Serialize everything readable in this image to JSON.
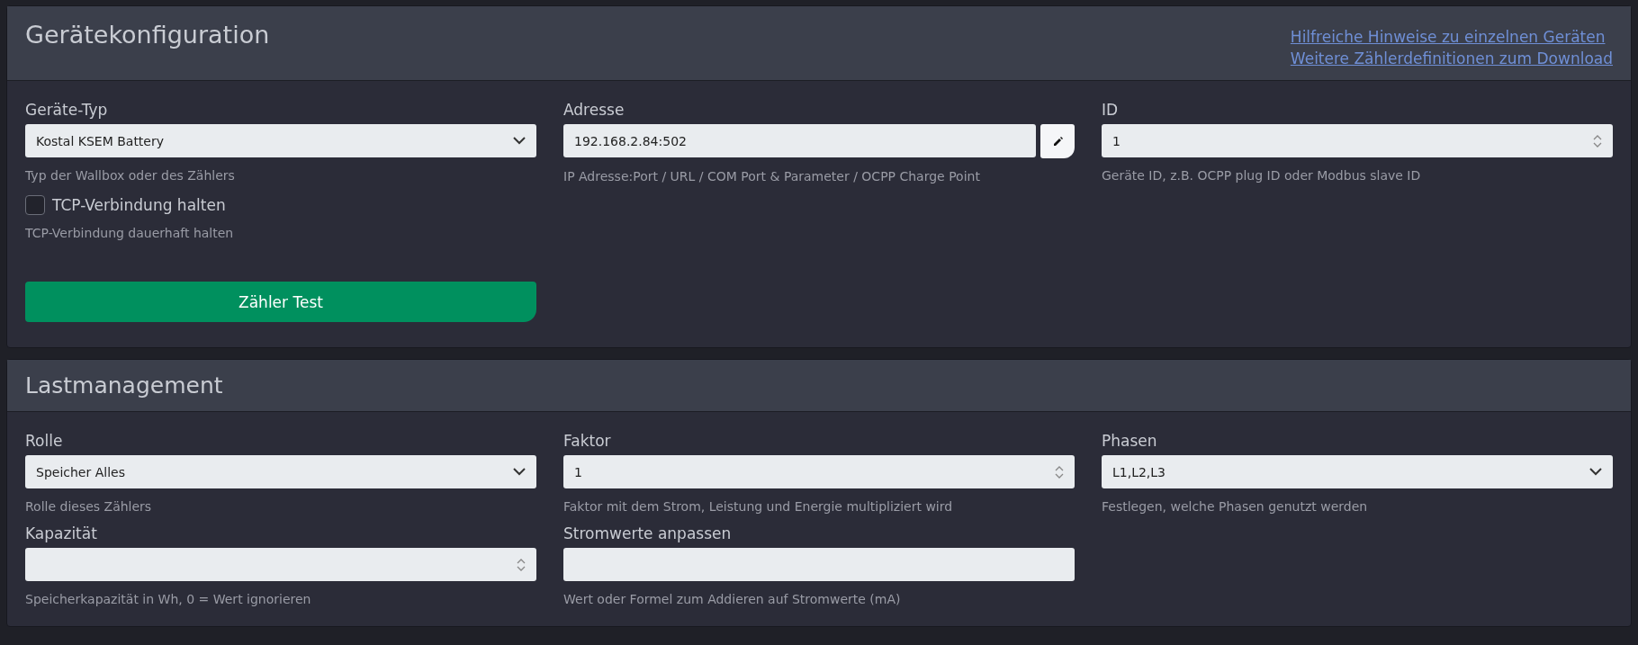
{
  "panels": [
    {
      "title": "Gerätekonfiguration",
      "links": [
        "Hilfreiche Hinweise zu einzelnen Geräten",
        "Weitere Zählerdefinitionen zum Download"
      ],
      "columns": [
        [
          {
            "kind": "select",
            "label": "Geräte-Typ",
            "value": "Kostal KSEM Battery",
            "hint": "Typ der Wallbox oder des Zählers"
          },
          {
            "kind": "checkbox",
            "label": "TCP-Verbindung halten",
            "checked": false,
            "hint": "TCP-Verbindung dauerhaft halten"
          },
          {
            "kind": "button",
            "label": "Zähler Test"
          }
        ],
        [
          {
            "kind": "text-button",
            "label": "Adresse",
            "value": "192.168.2.84:502",
            "hint": "IP Adresse:Port / URL / COM Port & Parameter / OCPP Charge Point"
          }
        ],
        [
          {
            "kind": "number",
            "label": "ID",
            "value": "1",
            "hint": "Geräte ID, z.B. OCPP plug ID oder Modbus slave ID"
          }
        ]
      ]
    },
    {
      "title": "Lastmanagement",
      "columns": [
        [
          {
            "kind": "select",
            "label": "Rolle",
            "value": "Speicher Alles",
            "hint": "Rolle dieses Zählers"
          },
          {
            "kind": "number",
            "label": "Kapazität",
            "hint": "Speicherkapazität in Wh, 0 = Wert ignorieren"
          }
        ],
        [
          {
            "kind": "number",
            "label": "Faktor",
            "value": "1",
            "hint": "Faktor mit dem Strom, Leistung und Energie multipliziert wird"
          },
          {
            "kind": "text",
            "label": "Stromwerte anpassen",
            "hint": "Wert oder Formel zum Addieren auf Stromwerte (mA)"
          }
        ],
        [
          {
            "kind": "select",
            "label": "Phasen",
            "value": "L1,L2,L3",
            "hint": "Festlegen, welche Phasen genutzt werden"
          }
        ]
      ]
    }
  ]
}
